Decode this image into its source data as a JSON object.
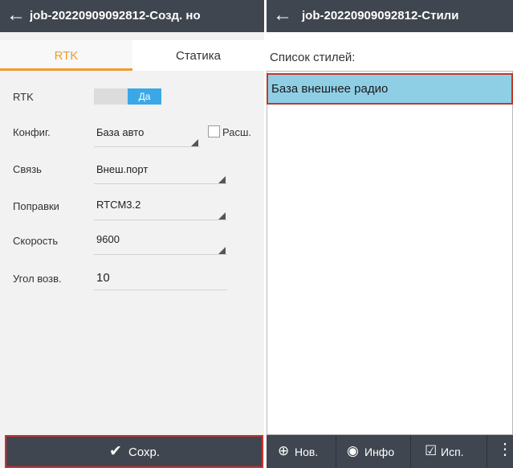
{
  "left": {
    "title": "job-20220909092812-Созд. но",
    "tabs": [
      "RTK",
      "Статика"
    ],
    "fields": {
      "rtk": {
        "label": "RTK",
        "toggle_on": "Да"
      },
      "config": {
        "label": "Конфиг.",
        "value": "База авто",
        "checkbox_label": "Расш."
      },
      "link": {
        "label": "Связь",
        "value": "Внеш.порт"
      },
      "corrections": {
        "label": "Поправки",
        "value": "RTCM3.2"
      },
      "speed": {
        "label": "Скорость",
        "value": "9600"
      },
      "elevation": {
        "label": "Угол возв.",
        "value": "10"
      }
    },
    "save_label": "Сохр."
  },
  "right": {
    "title": "job-20220909092812-Стили",
    "section_label": "Список стилей:",
    "styles": [
      "База внешнее радио"
    ],
    "buttons": {
      "new": "Нов.",
      "info": "Инфо",
      "use": "Исп."
    }
  },
  "colors": {
    "appbar": "#404650",
    "accent": "#f29a2e",
    "toggle_on": "#3aa7e6",
    "selected_item": "#8fcfe6",
    "highlight_border": "#d03030"
  },
  "icons": {
    "back": "back-arrow-icon",
    "save": "checkmark-icon",
    "new": "add-location-icon",
    "info": "eye-icon",
    "use": "checkbox-check-icon",
    "more": "more-vertical-icon"
  }
}
